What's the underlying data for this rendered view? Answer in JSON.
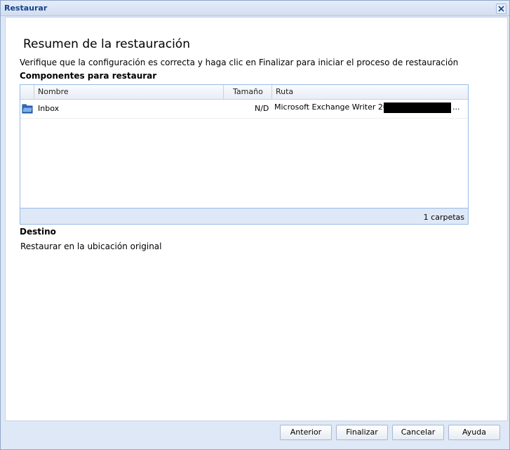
{
  "window": {
    "title": "Restaurar"
  },
  "summary": {
    "heading": "Resumen de la restauración",
    "description": "Verifique que la configuración es correcta y haga clic en Finalizar para iniciar el proceso de restauración",
    "components_title": "Componentes para restaurar"
  },
  "grid": {
    "columns": [
      "Nombre",
      "Tamaño",
      "Ruta"
    ],
    "rows": [
      {
        "icon": "folder-icon",
        "name": "Inbox",
        "size": "N/D",
        "path": "Microsoft Exchange Writer 2003",
        "ellipsis": "..."
      }
    ],
    "footer": "1 carpetas"
  },
  "destination": {
    "title": "Destino",
    "value": "Restaurar en la ubicación original"
  },
  "buttons": {
    "previous": "Anterior",
    "finish": "Finalizar",
    "cancel": "Cancelar",
    "help": "Ayuda"
  },
  "colors": {
    "title_text": "#15428b",
    "panel_bg": "#dfe8f6",
    "grid_border": "#99bbe8"
  }
}
